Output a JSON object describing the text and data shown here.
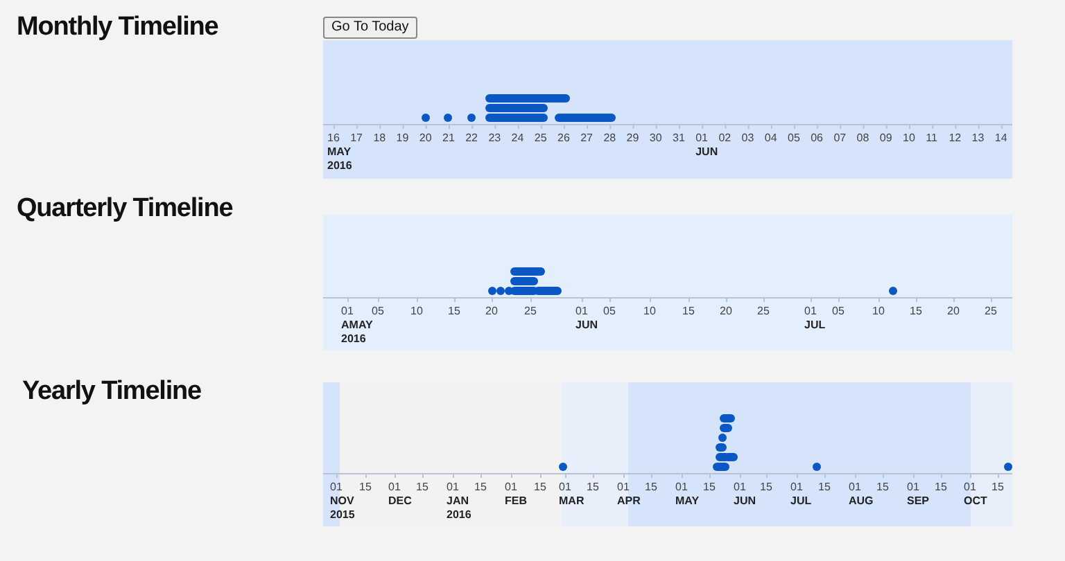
{
  "timelines": [
    {
      "kind": "monthly",
      "title": "Monthly Timeline",
      "button": "Go To Today",
      "ticks": [
        {
          "label": "16",
          "month": "MAY",
          "year": "2016"
        },
        {
          "label": "17"
        },
        {
          "label": "18"
        },
        {
          "label": "19"
        },
        {
          "label": "20"
        },
        {
          "label": "21"
        },
        {
          "label": "22"
        },
        {
          "label": "23"
        },
        {
          "label": "24"
        },
        {
          "label": "25"
        },
        {
          "label": "26"
        },
        {
          "label": "27"
        },
        {
          "label": "28"
        },
        {
          "label": "29"
        },
        {
          "label": "30"
        },
        {
          "label": "31"
        },
        {
          "label": "01",
          "month": "JUN"
        },
        {
          "label": "02"
        },
        {
          "label": "03"
        },
        {
          "label": "04"
        },
        {
          "label": "05"
        },
        {
          "label": "06"
        },
        {
          "label": "07"
        },
        {
          "label": "08"
        },
        {
          "label": "09"
        },
        {
          "label": "10"
        },
        {
          "label": "11"
        },
        {
          "label": "12"
        },
        {
          "label": "13"
        },
        {
          "label": "14"
        }
      ]
    },
    {
      "kind": "quarterly",
      "title": "Quarterly Timeline",
      "ticks": [
        {
          "label": "01",
          "month": "A",
          "month_2": "MAY",
          "year": "2016"
        },
        {
          "label": "05"
        },
        {
          "label": "10"
        },
        {
          "label": "15"
        },
        {
          "label": "20"
        },
        {
          "label": "25"
        },
        {
          "label": "01",
          "month": "JUN"
        },
        {
          "label": "05"
        },
        {
          "label": "10"
        },
        {
          "label": "15"
        },
        {
          "label": "20"
        },
        {
          "label": "25"
        },
        {
          "label": "01",
          "month": "JUL"
        },
        {
          "label": "05"
        },
        {
          "label": "10"
        },
        {
          "label": "15"
        },
        {
          "label": "20"
        },
        {
          "label": "25"
        }
      ]
    },
    {
      "kind": "yearly",
      "title": "Yearly Timeline",
      "ticks": [
        {
          "label": "01",
          "month": "NOV",
          "year": "2015"
        },
        {
          "label": "15"
        },
        {
          "label": "01",
          "month": "DEC"
        },
        {
          "label": "15"
        },
        {
          "label": "01",
          "month": "JAN",
          "year": "2016"
        },
        {
          "label": "15"
        },
        {
          "label": "01",
          "month": "FEB"
        },
        {
          "label": "15"
        },
        {
          "label": "01",
          "month": "MAR"
        },
        {
          "label": "15"
        },
        {
          "label": "01",
          "month": "APR"
        },
        {
          "label": "15"
        },
        {
          "label": "01",
          "month": "MAY"
        },
        {
          "label": "15"
        },
        {
          "label": "01",
          "month": "JUN"
        },
        {
          "label": "15"
        },
        {
          "label": "01",
          "month": "JUL"
        },
        {
          "label": "15"
        },
        {
          "label": "01",
          "month": "AUG"
        },
        {
          "label": "15"
        },
        {
          "label": "01",
          "month": "SEP"
        },
        {
          "label": "15"
        },
        {
          "label": "01",
          "month": "OCT"
        },
        {
          "label": "15"
        }
      ]
    }
  ]
}
